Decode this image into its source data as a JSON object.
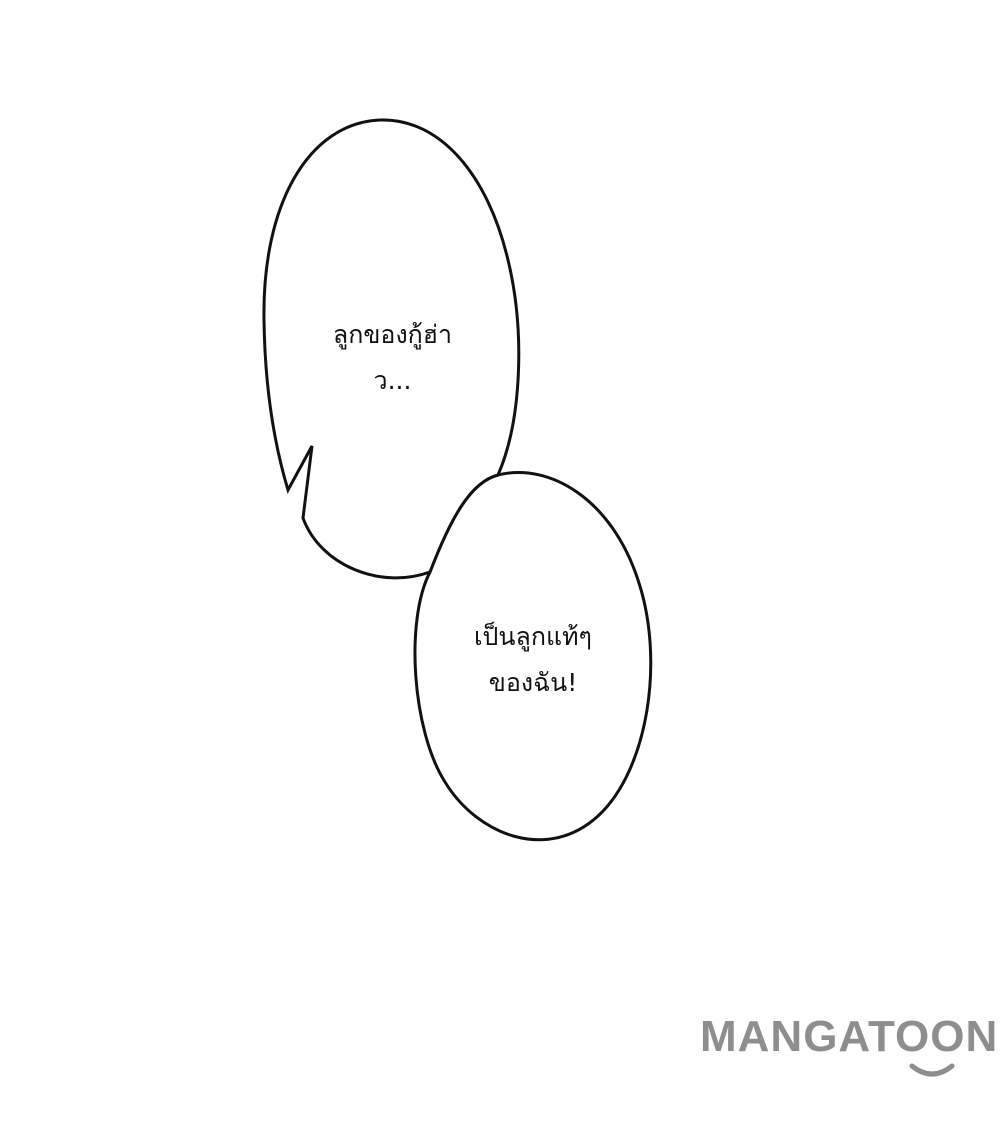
{
  "bubbles": [
    {
      "lines": [
        "ลูกของกู้ฮ่า",
        "ว..."
      ]
    },
    {
      "lines": [
        "เป็นลูกแท้ๆ",
        "ของฉัน!"
      ]
    }
  ],
  "watermark": {
    "text": "MANGATOON",
    "color": "#8e8e8e"
  },
  "colors": {
    "background": "#ffffff",
    "outline": "#111111"
  }
}
